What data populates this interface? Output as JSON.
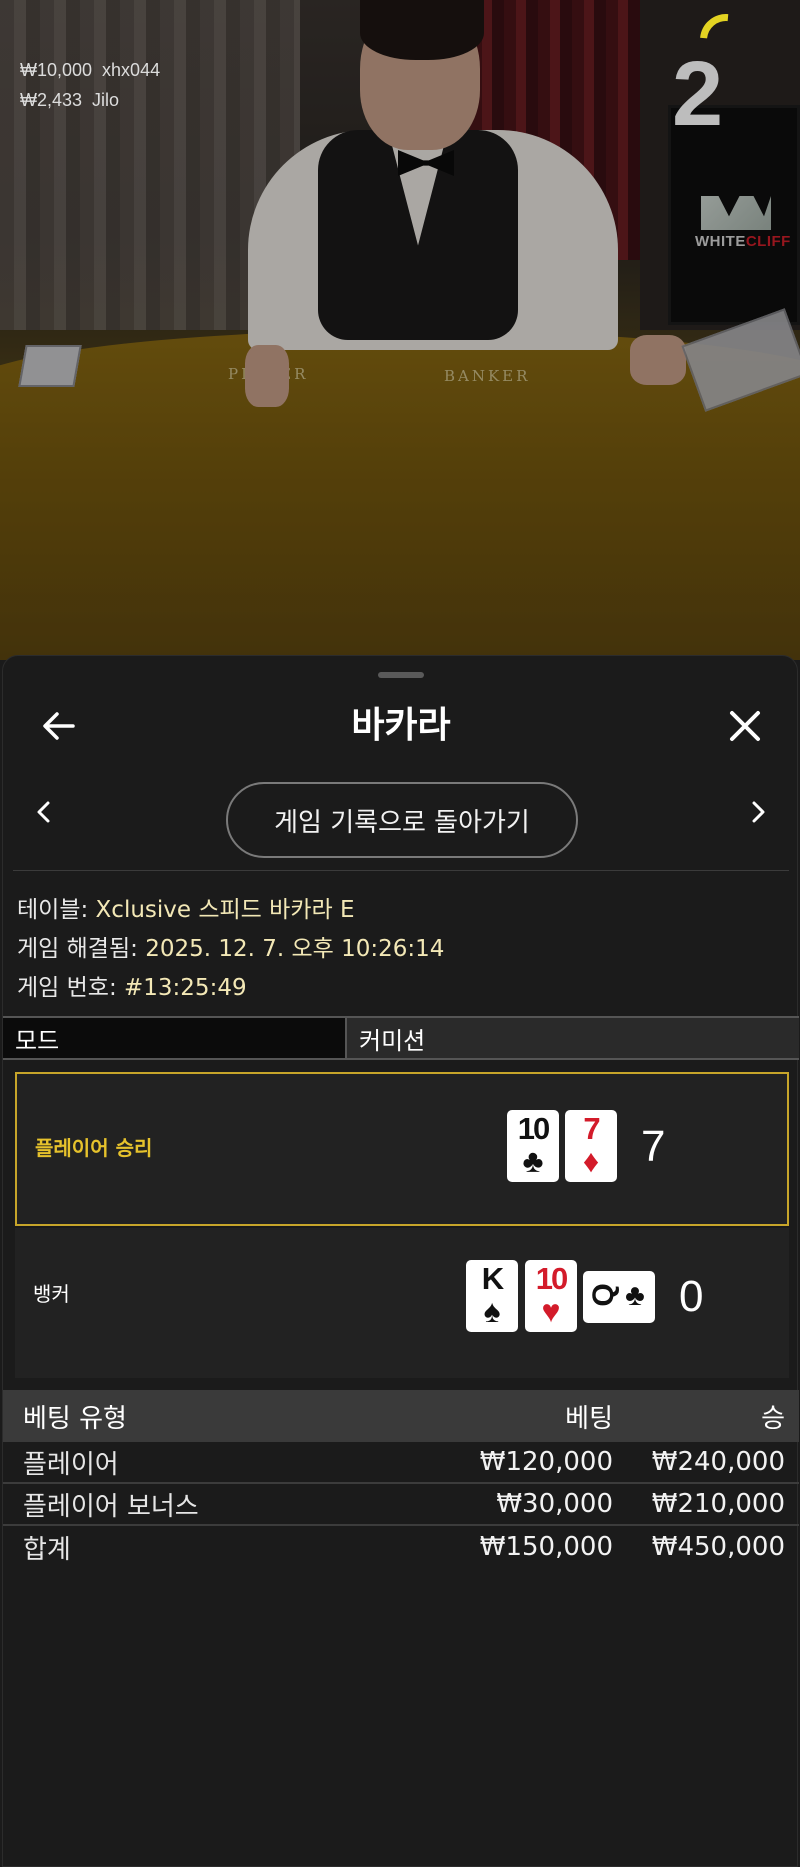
{
  "video": {
    "recent_wins": [
      {
        "amount": "₩10,000",
        "user": "xhx044"
      },
      {
        "amount": "₩2,433",
        "user": "Jilo"
      }
    ],
    "round_countdown": "2",
    "table_labels": {
      "player": "PLAYER",
      "banker": "BANKER"
    },
    "brand_logo": {
      "part1": "WHITE",
      "part2": "CLIFF"
    }
  },
  "header": {
    "title": "바카라",
    "back_icon": "arrow-left-icon",
    "close_icon": "close-x-icon"
  },
  "history_nav": {
    "back_to_history_label": "게임 기록으로 돌아가기",
    "prev_icon": "chevron-left-icon",
    "next_icon": "chevron-right-icon"
  },
  "game_info": {
    "table_label": "테이블:",
    "table_value": "Xclusive 스피드 바카라 E",
    "resolved_label": "게임 해결됨:",
    "resolved_value": "2025. 12. 7. 오후 10:26:14",
    "number_label": "게임 번호:",
    "number_value": "#13:25:49"
  },
  "mode_bar": {
    "mode_label": "모드",
    "commission_label": "커미션"
  },
  "results": {
    "player": {
      "label": "플레이어 승리",
      "score": "7",
      "cards": [
        {
          "rank": "10",
          "suit": "♣",
          "color": "#111111"
        },
        {
          "rank": "7",
          "suit": "♦",
          "color": "#d31b2a"
        }
      ]
    },
    "banker": {
      "label": "뱅커",
      "score": "0",
      "cards": [
        {
          "rank": "K",
          "suit": "♠",
          "color": "#111111"
        },
        {
          "rank": "10",
          "suit": "♥",
          "color": "#d31b2a"
        },
        {
          "rank": "Q",
          "suit": "♣",
          "color": "#111111",
          "rotated": true
        }
      ]
    },
    "win_color": "#e6c22c"
  },
  "bet_table": {
    "headers": {
      "type": "베팅 유형",
      "bet": "베팅",
      "win": "승"
    },
    "rows": [
      {
        "type": "플레이어",
        "bet": "₩120,000",
        "win": "₩240,000"
      },
      {
        "type": "플레이어 보너스",
        "bet": "₩30,000",
        "win": "₩210,000"
      }
    ],
    "total": {
      "type": "합계",
      "bet": "₩150,000",
      "win": "₩450,000"
    }
  }
}
